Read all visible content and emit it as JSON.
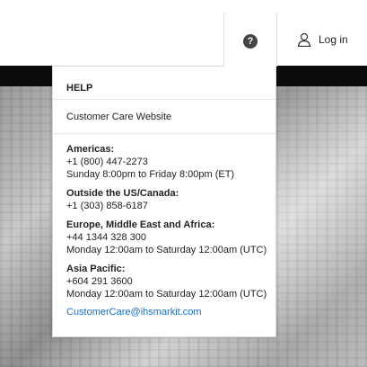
{
  "header": {
    "help_icon_glyph": "?",
    "login_label": "Log in"
  },
  "help_panel": {
    "title": "HELP",
    "website_link": "Customer Care Website",
    "regions": [
      {
        "name": "Americas:",
        "lines": [
          "+1 (800) 447-2273",
          "Sunday 8:00pm to Friday 8:00pm (ET)"
        ]
      },
      {
        "name": "Outside the US/Canada:",
        "lines": [
          "+1 (303) 858-6187"
        ]
      },
      {
        "name": "Europe, Middle East and Africa:",
        "lines": [
          "+44 1344 328 300",
          "Monday 12:00am to Saturday 12:00am (UTC)"
        ]
      },
      {
        "name": "Asia Pacific:",
        "lines": [
          "+604 291 3600",
          "Monday 12:00am to Saturday 12:00am (UTC)"
        ]
      }
    ],
    "email": "CustomerCare@ihsmarkit.com"
  },
  "colors": {
    "link": "#1a6ec0",
    "dark_band": "#0b0b0b"
  }
}
